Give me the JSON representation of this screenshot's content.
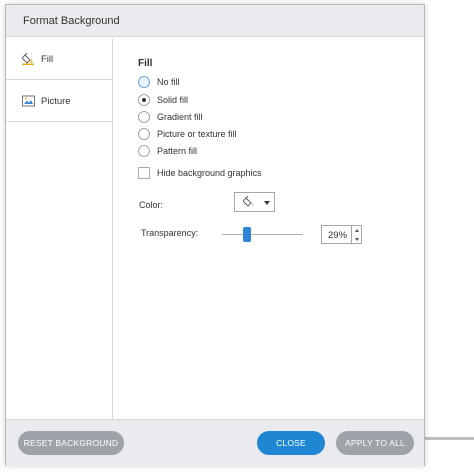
{
  "dialog": {
    "title": "Format Background"
  },
  "sidebar": {
    "items": [
      {
        "label": "Fill",
        "icon": "paint-bucket-icon",
        "selected": true
      },
      {
        "label": "Picture",
        "icon": "picture-icon",
        "selected": false
      }
    ]
  },
  "fill": {
    "section_title": "Fill",
    "options": [
      {
        "label": "No fill",
        "checked": false
      },
      {
        "label": "Solid fill",
        "checked": true
      },
      {
        "label": "Gradient fill",
        "checked": false
      },
      {
        "label": "Picture or texture fill",
        "checked": false
      },
      {
        "label": "Pattern fill",
        "checked": false
      }
    ],
    "hide_graphics_label": "Hide background graphics",
    "hide_graphics_checked": false,
    "color_label": "Color:",
    "color_button_icon": "paint-bucket-icon",
    "transparency_label": "Transparency:",
    "transparency_value": "29%",
    "transparency_fraction": 0.29
  },
  "footer": {
    "reset_label": "RESET BACKGROUND",
    "close_label": "CLOSE",
    "apply_label": "APPLY TO ALL"
  },
  "colors": {
    "accent": "#1f86d3",
    "slider_thumb": "#2f86d6",
    "secondary_button": "#9ea3a9",
    "titlebar": "#e9ebee"
  }
}
